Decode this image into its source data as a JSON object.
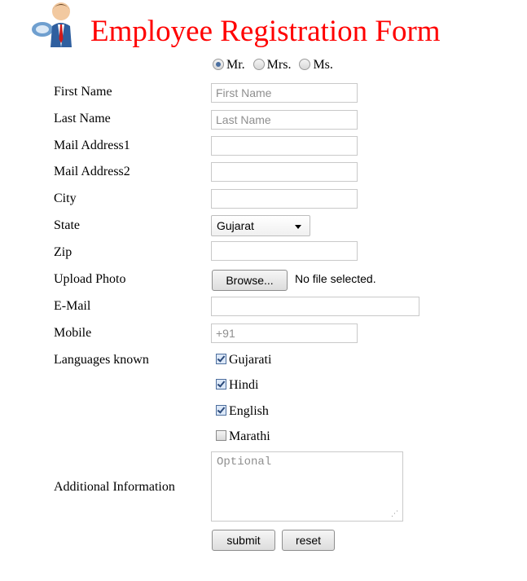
{
  "header": {
    "title": "Employee Registration Form",
    "logo_icon": "employee-icon"
  },
  "salutation": {
    "options": [
      "Mr.",
      "Mrs.",
      "Ms."
    ],
    "selected": "Mr."
  },
  "labels": {
    "first_name": "First Name",
    "last_name": "Last Name",
    "mail1": "Mail Address1",
    "mail2": "Mail Address2",
    "city": "City",
    "state": "State",
    "zip": "Zip",
    "photo": "Upload Photo",
    "email": "E-Mail",
    "mobile": "Mobile",
    "languages": "Languages known",
    "additional": "Additional Information"
  },
  "fields": {
    "first_name_placeholder": "First Name",
    "last_name_placeholder": "Last Name",
    "mobile_placeholder": "+91",
    "additional_placeholder": "Optional",
    "state_value": "Gujarat"
  },
  "upload": {
    "button": "Browse...",
    "status": "No file selected."
  },
  "languages": [
    {
      "label": "Gujarati",
      "checked": true
    },
    {
      "label": "Hindi",
      "checked": true
    },
    {
      "label": "English",
      "checked": true
    },
    {
      "label": "Marathi",
      "checked": false
    }
  ],
  "buttons": {
    "submit": "submit",
    "reset": "reset"
  },
  "colors": {
    "title": "#ff0000"
  }
}
